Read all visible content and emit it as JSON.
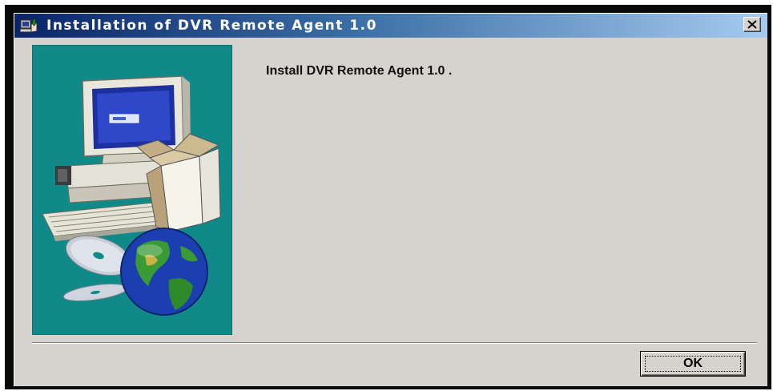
{
  "window": {
    "title": "Installation of DVR Remote Agent 1.0",
    "icon": "installer-icon",
    "close_icon": "close-icon"
  },
  "side_image": {
    "name": "computer-setup-illustration",
    "background": "#0f8a88"
  },
  "main": {
    "message": "Install DVR Remote Agent 1.0 ."
  },
  "buttons": {
    "ok_label": "OK"
  },
  "colors": {
    "titlebar_start": "#0a246a",
    "titlebar_end": "#a6caf0",
    "dialog_face": "#d6d3ce"
  }
}
